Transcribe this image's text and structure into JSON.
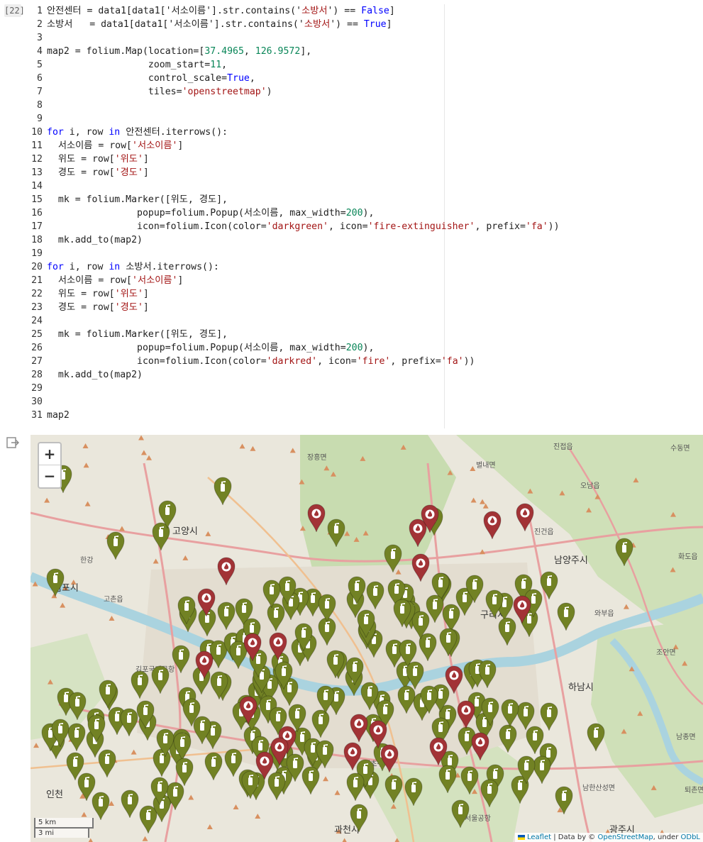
{
  "cell": {
    "exec_count": "[22]",
    "lines": [
      {
        "n": "1",
        "parts": [
          [
            "t",
            "안전센터 = data1[data1['서소이름'].str.contains('"
          ],
          [
            "s",
            "소방서"
          ],
          [
            "t",
            "') == "
          ],
          [
            "k",
            "False"
          ],
          [
            "t",
            "]"
          ]
        ]
      },
      {
        "n": "2",
        "parts": [
          [
            "t",
            "소방서   = data1[data1['서소이름'].str.contains('"
          ],
          [
            "s",
            "소방서"
          ],
          [
            "t",
            "') == "
          ],
          [
            "k",
            "True"
          ],
          [
            "t",
            "]"
          ]
        ]
      },
      {
        "n": "3",
        "parts": []
      },
      {
        "n": "4",
        "parts": [
          [
            "t",
            "map2 = folium.Map(location=["
          ],
          [
            "n",
            "37.4965"
          ],
          [
            "t",
            ", "
          ],
          [
            "n",
            "126.9572"
          ],
          [
            "t",
            "],"
          ]
        ]
      },
      {
        "n": "5",
        "parts": [
          [
            "t",
            "                  zoom_start="
          ],
          [
            "n",
            "11"
          ],
          [
            "t",
            ","
          ]
        ]
      },
      {
        "n": "6",
        "parts": [
          [
            "t",
            "                  control_scale="
          ],
          [
            "k",
            "True"
          ],
          [
            "t",
            ","
          ]
        ]
      },
      {
        "n": "7",
        "parts": [
          [
            "t",
            "                  tiles="
          ],
          [
            "s",
            "'openstreetmap'"
          ],
          [
            "t",
            ")"
          ]
        ]
      },
      {
        "n": "8",
        "parts": []
      },
      {
        "n": "9",
        "parts": []
      },
      {
        "n": "10",
        "parts": [
          [
            "k",
            "for"
          ],
          [
            "t",
            " i, row "
          ],
          [
            "k",
            "in"
          ],
          [
            "t",
            " 안전센터.iterrows():"
          ]
        ]
      },
      {
        "n": "11",
        "parts": [
          [
            "t",
            "  서소이름 = row["
          ],
          [
            "s",
            "'서소이름'"
          ],
          [
            "t",
            "]"
          ]
        ]
      },
      {
        "n": "12",
        "parts": [
          [
            "t",
            "  위도 = row["
          ],
          [
            "s",
            "'위도'"
          ],
          [
            "t",
            "]"
          ]
        ]
      },
      {
        "n": "13",
        "parts": [
          [
            "t",
            "  경도 = row["
          ],
          [
            "s",
            "'경도'"
          ],
          [
            "t",
            "]"
          ]
        ]
      },
      {
        "n": "14",
        "parts": []
      },
      {
        "n": "15",
        "parts": [
          [
            "t",
            "  mk = folium.Marker([위도, 경도],"
          ]
        ]
      },
      {
        "n": "16",
        "parts": [
          [
            "t",
            "                popup=folium.Popup(서소이름, max_width="
          ],
          [
            "n",
            "200"
          ],
          [
            "t",
            "),"
          ]
        ]
      },
      {
        "n": "17",
        "parts": [
          [
            "t",
            "                icon=folium.Icon(color="
          ],
          [
            "s",
            "'darkgreen'"
          ],
          [
            "t",
            ", icon="
          ],
          [
            "s",
            "'fire-extinguisher'"
          ],
          [
            "t",
            ", prefix="
          ],
          [
            "s",
            "'fa'"
          ],
          [
            "t",
            "))"
          ]
        ]
      },
      {
        "n": "18",
        "parts": [
          [
            "t",
            "  mk.add_to(map2)"
          ]
        ]
      },
      {
        "n": "19",
        "parts": []
      },
      {
        "n": "20",
        "parts": [
          [
            "k",
            "for"
          ],
          [
            "t",
            " i, row "
          ],
          [
            "k",
            "in"
          ],
          [
            "t",
            " 소방서.iterrows():"
          ]
        ]
      },
      {
        "n": "21",
        "parts": [
          [
            "t",
            "  서소이름 = row["
          ],
          [
            "s",
            "'서소이름'"
          ],
          [
            "t",
            "]"
          ]
        ]
      },
      {
        "n": "22",
        "parts": [
          [
            "t",
            "  위도 = row["
          ],
          [
            "s",
            "'위도'"
          ],
          [
            "t",
            "]"
          ]
        ]
      },
      {
        "n": "23",
        "parts": [
          [
            "t",
            "  경도 = row["
          ],
          [
            "s",
            "'경도'"
          ],
          [
            "t",
            "]"
          ]
        ]
      },
      {
        "n": "24",
        "parts": []
      },
      {
        "n": "25",
        "parts": [
          [
            "t",
            "  mk = folium.Marker([위도, 경도],"
          ]
        ]
      },
      {
        "n": "26",
        "parts": [
          [
            "t",
            "                popup=folium.Popup(서소이름, max_width="
          ],
          [
            "n",
            "200"
          ],
          [
            "t",
            "),"
          ]
        ]
      },
      {
        "n": "27",
        "parts": [
          [
            "t",
            "                icon=folium.Icon(color="
          ],
          [
            "s",
            "'darkred'"
          ],
          [
            "t",
            ", icon="
          ],
          [
            "s",
            "'fire'"
          ],
          [
            "t",
            ", prefix="
          ],
          [
            "s",
            "'fa'"
          ],
          [
            "t",
            "))"
          ]
        ]
      },
      {
        "n": "28",
        "parts": [
          [
            "t",
            "  mk.add_to(map2)"
          ]
        ]
      },
      {
        "n": "29",
        "parts": []
      },
      {
        "n": "30",
        "parts": []
      },
      {
        "n": "31",
        "parts": [
          [
            "t",
            "map2"
          ]
        ]
      }
    ]
  },
  "map": {
    "zoom_in": "+",
    "zoom_out": "−",
    "scale_km": "5 km",
    "scale_mi": "3 mi",
    "attribution": {
      "leaflet": "Leaflet",
      "sep": " | Data by © ",
      "osm": "OpenStreetMap",
      "tail": ", under ",
      "odbl": "ODbL"
    },
    "colors": {
      "green_marker": "#728224",
      "red_marker": "#a23336",
      "land": "#eae7dc",
      "green_area": "#c8dcb0",
      "river": "#aad3df",
      "road": "#e8a0a0"
    },
    "icons": {
      "green": "fire-extinguisher-icon",
      "red": "fire-icon"
    },
    "places": [
      {
        "name": "장흥면",
        "size": "small"
      },
      {
        "name": "별내면",
        "size": "small"
      },
      {
        "name": "진접읍",
        "size": "small"
      },
      {
        "name": "수동면",
        "size": "small"
      },
      {
        "name": "오남읍",
        "size": "small"
      },
      {
        "name": "고양시",
        "size": "big"
      },
      {
        "name": "진건읍",
        "size": "small"
      },
      {
        "name": "화도읍",
        "size": "small"
      },
      {
        "name": "남양주시",
        "size": "big"
      },
      {
        "name": "김포시",
        "size": "big"
      },
      {
        "name": "고촌읍",
        "size": "small"
      },
      {
        "name": "구리시",
        "size": "big"
      },
      {
        "name": "와부읍",
        "size": "small"
      },
      {
        "name": "조안면",
        "size": "small"
      },
      {
        "name": "하남시",
        "size": "big"
      },
      {
        "name": "남종면",
        "size": "small"
      },
      {
        "name": "김포국제공항",
        "size": "small"
      },
      {
        "name": "남한산성면",
        "size": "small"
      },
      {
        "name": "퇴촌면",
        "size": "small"
      },
      {
        "name": "인천",
        "size": "big"
      },
      {
        "name": "과천시",
        "size": "big"
      },
      {
        "name": "광주시",
        "size": "big"
      },
      {
        "name": "서울공항",
        "size": "small"
      },
      {
        "name": "한강",
        "size": "small"
      },
      {
        "name": "서초구",
        "size": "small"
      }
    ],
    "green_markers": 190,
    "red_markers": 24
  }
}
